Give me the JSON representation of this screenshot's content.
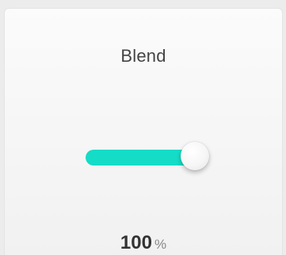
{
  "control": {
    "label": "Blend",
    "value": "100",
    "unit": "%",
    "level": 1.0
  },
  "colors": {
    "accent": "#14dcc6",
    "track": "#d8d8d8"
  }
}
